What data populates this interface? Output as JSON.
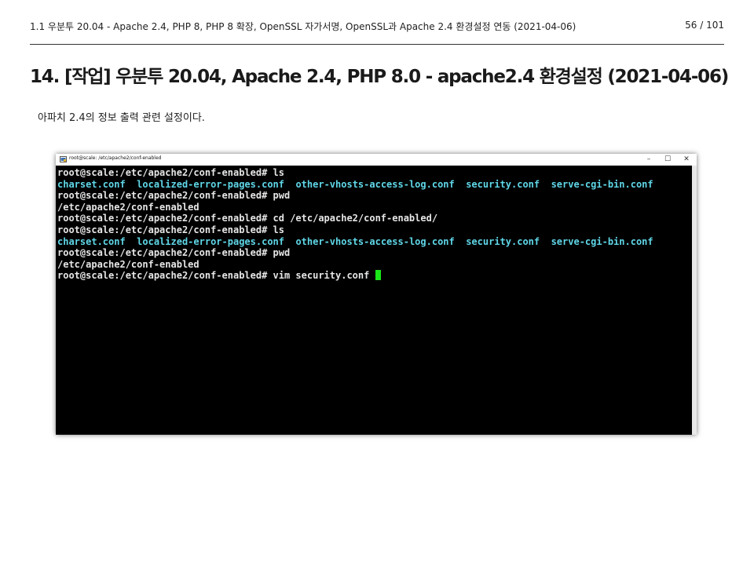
{
  "header": {
    "running_title": "1.1 우분투 20.04 - Apache 2.4, PHP 8, PHP 8 확장, OpenSSL 자가서명, OpenSSL과 Apache 2.4 환경설정 연동 (2021-04-06)",
    "page_number": "56 / 101"
  },
  "main": {
    "title": "14. [작업] 우분투 20.04, Apache 2.4, PHP 8.0 - apache2.4 환경설정 (2021-04-06)",
    "description": "아파치 2.4의 정보 출력 관련 설정이다."
  },
  "terminal": {
    "window_title": "root@scale: /etc/apache2/conf-enabled",
    "controls": {
      "minimize": "–",
      "maximize": "☐",
      "close": "✕"
    },
    "colors": {
      "background": "#000000",
      "text": "#e6e6e6",
      "ls_file": "#5fd7e8",
      "cursor": "#19e619"
    },
    "lines": [
      {
        "text": "root@scale:/etc/apache2/conf-enabled# ls"
      },
      {
        "files": [
          "charset.conf",
          "localized-error-pages.conf",
          "other-vhosts-access-log.conf",
          "security.conf",
          "serve-cgi-bin.conf"
        ]
      },
      {
        "text": "root@scale:/etc/apache2/conf-enabled# pwd"
      },
      {
        "text": "/etc/apache2/conf-enabled"
      },
      {
        "text": "root@scale:/etc/apache2/conf-enabled# cd /etc/apache2/conf-enabled/"
      },
      {
        "text": "root@scale:/etc/apache2/conf-enabled# ls"
      },
      {
        "files": [
          "charset.conf",
          "localized-error-pages.conf",
          "other-vhosts-access-log.conf",
          "security.conf",
          "serve-cgi-bin.conf"
        ]
      },
      {
        "text": "root@scale:/etc/apache2/conf-enabled# pwd"
      },
      {
        "text": "/etc/apache2/conf-enabled"
      },
      {
        "text": "root@scale:/etc/apache2/conf-enabled# vim security.conf "
      }
    ]
  }
}
